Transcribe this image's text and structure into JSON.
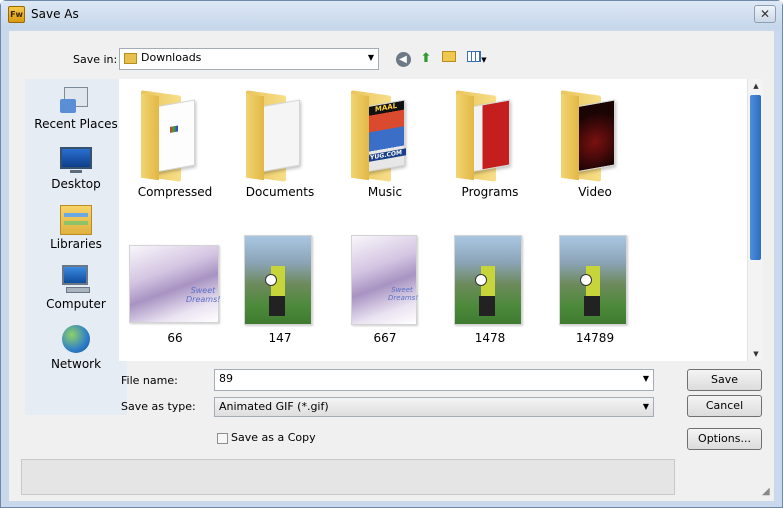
{
  "window": {
    "title": "Save As",
    "app_icon": "Fw"
  },
  "header": {
    "save_in_label": "Save in:",
    "save_in_value": "Downloads"
  },
  "toolbar": {
    "back_icon": "back-arrow-icon",
    "up_icon": "up-folder-icon",
    "new_folder_icon": "new-folder-icon",
    "views_icon": "views-menu-icon"
  },
  "places": [
    {
      "label": "Recent Places",
      "icon": "recent-places-icon"
    },
    {
      "label": "Desktop",
      "icon": "desktop-icon"
    },
    {
      "label": "Libraries",
      "icon": "libraries-icon"
    },
    {
      "label": "Computer",
      "icon": "computer-icon"
    },
    {
      "label": "Network",
      "icon": "network-icon"
    }
  ],
  "files": [
    {
      "name": "Compressed",
      "kind": "folder"
    },
    {
      "name": "Documents",
      "kind": "folder"
    },
    {
      "name": "Music",
      "kind": "folder"
    },
    {
      "name": "Programs",
      "kind": "folder"
    },
    {
      "name": "Video",
      "kind": "folder"
    },
    {
      "name": "66",
      "kind": "image"
    },
    {
      "name": "147",
      "kind": "image"
    },
    {
      "name": "667",
      "kind": "image"
    },
    {
      "name": "1478",
      "kind": "image"
    },
    {
      "name": "14789",
      "kind": "image"
    }
  ],
  "music_cover_text": {
    "top": "MAAL",
    "bottom": "YUG.COM"
  },
  "fairy_caption": "Sweet Dreams!",
  "form": {
    "filename_label": "File name:",
    "filename_value": "89",
    "type_label": "Save as type:",
    "type_value": "Animated GIF (*.gif)",
    "copy_label": "Save as a Copy"
  },
  "buttons": {
    "save": "Save",
    "cancel": "Cancel",
    "options": "Options..."
  },
  "colors": {
    "accent": "#2e6cc0",
    "folder": "#f2d472",
    "frame": "#c9d8ea"
  }
}
